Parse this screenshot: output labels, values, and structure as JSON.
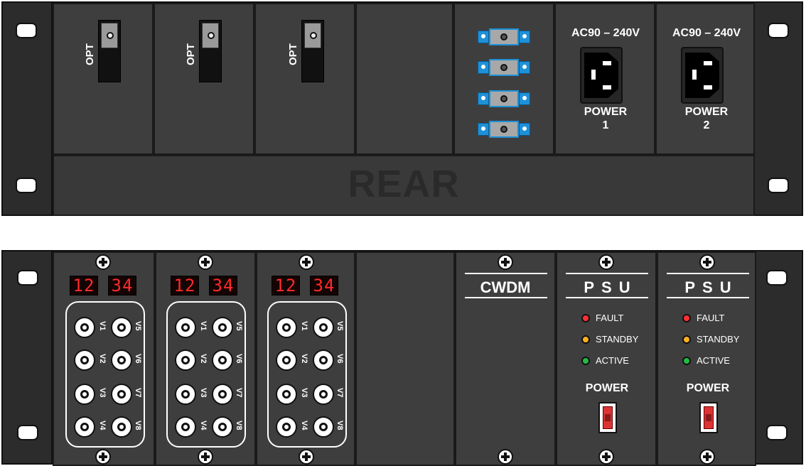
{
  "rear": {
    "panel_label": "REAR",
    "opt_modules": [
      {
        "label": "OPT"
      },
      {
        "label": "OPT"
      },
      {
        "label": "OPT"
      }
    ],
    "power_inputs": [
      {
        "rating": "AC90 – 240V",
        "label_line1": "POWER",
        "label_line2": "1"
      },
      {
        "rating": "AC90 – 240V",
        "label_line1": "POWER",
        "label_line2": "2"
      }
    ],
    "fiber_ports_count": 4
  },
  "front": {
    "video_modules": [
      {
        "display_left": "12",
        "display_right": "34",
        "channels": [
          "V1",
          "V2",
          "V3",
          "V4",
          "V5",
          "V6",
          "V7",
          "V8"
        ]
      },
      {
        "display_left": "12",
        "display_right": "34",
        "channels": [
          "V1",
          "V2",
          "V3",
          "V4",
          "V5",
          "V6",
          "V7",
          "V8"
        ]
      },
      {
        "display_left": "12",
        "display_right": "34",
        "channels": [
          "V1",
          "V2",
          "V3",
          "V4",
          "V5",
          "V6",
          "V7",
          "V8"
        ]
      }
    ],
    "cwdm": {
      "title": "CWDM"
    },
    "psus": [
      {
        "title": "PSU",
        "led_fault": "FAULT",
        "led_standby": "STANDBY",
        "led_active": "ACTIVE",
        "power_label": "POWER"
      },
      {
        "title": "PSU",
        "led_fault": "FAULT",
        "led_standby": "STANDBY",
        "led_active": "ACTIVE",
        "power_label": "POWER"
      }
    ]
  },
  "colors": {
    "led_fault": "#ff3030",
    "led_standby": "#ffb020",
    "led_active": "#22bb44",
    "fiber_blue": "#1e90d8",
    "display_red": "#ff2a2a"
  }
}
